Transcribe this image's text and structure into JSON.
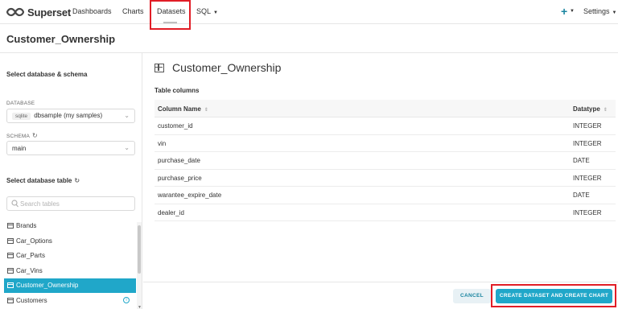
{
  "app": {
    "name": "Superset"
  },
  "nav": {
    "items": [
      "Dashboards",
      "Charts",
      "Datasets",
      "SQL"
    ],
    "active": "Datasets",
    "plus_label": "+",
    "settings_label": "Settings"
  },
  "page": {
    "title": "Customer_Ownership"
  },
  "left": {
    "db_section_title": "Select database & schema",
    "database_label": "DATABASE",
    "database_tag": "sqlite",
    "database_value": "dbsample (my samples)",
    "schema_label": "SCHEMA",
    "schema_value": "main",
    "table_section_title": "Select database table",
    "search_placeholder": "Search tables",
    "tables": [
      "Brands",
      "Car_Options",
      "Car_Parts",
      "Car_Vins",
      "Customer_Ownership",
      "Customers"
    ],
    "selected_table": "Customer_Ownership"
  },
  "right": {
    "dataset_title": "Customer_Ownership",
    "columns_label": "Table columns",
    "headers": {
      "name": "Column Name",
      "type": "Datatype"
    },
    "columns": [
      {
        "name": "customer_id",
        "type": "INTEGER"
      },
      {
        "name": "vin",
        "type": "INTEGER"
      },
      {
        "name": "purchase_date",
        "type": "DATE"
      },
      {
        "name": "purchase_price",
        "type": "INTEGER"
      },
      {
        "name": "warantee_expire_date",
        "type": "DATE"
      },
      {
        "name": "dealer_id",
        "type": "INTEGER"
      }
    ]
  },
  "footer": {
    "cancel_label": "CANCEL",
    "create_label": "CREATE DATASET AND CREATE CHART"
  },
  "colors": {
    "accent": "#20a7c9",
    "highlight_box": "#e11d26"
  }
}
